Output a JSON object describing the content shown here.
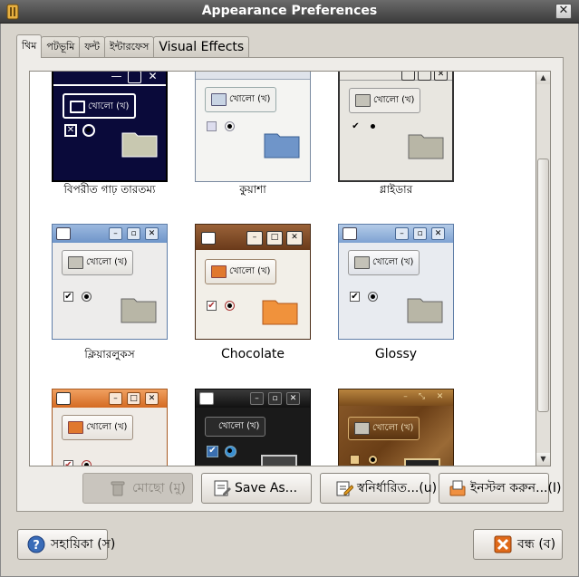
{
  "window": {
    "title": "Appearance Preferences",
    "close_glyph": "✕"
  },
  "tabs": [
    {
      "label": "থিম"
    },
    {
      "label": "পটভূমি"
    },
    {
      "label": "ফন্ট"
    },
    {
      "label": "ইন্টারফেস"
    },
    {
      "label": "Visual Effects"
    }
  ],
  "themes": [
    {
      "label": "বিপরীত গাঢ় তারতম্য",
      "button_text": "খোলো (খ)",
      "english": false
    },
    {
      "label": "কুয়াশা",
      "button_text": "খোলো (খ)",
      "english": false
    },
    {
      "label": "গ্লাইডার",
      "button_text": "খোলো (খ)",
      "english": false
    },
    {
      "label": "ক্লিয়ারলুকস",
      "button_text": "খোলো (খ)",
      "english": false
    },
    {
      "label": "Chocolate",
      "button_text": "খোলো (খ)",
      "english": true
    },
    {
      "label": "Glossy",
      "button_text": "খোলো (খ)",
      "english": true
    },
    {
      "label": "",
      "button_text": "খোলো (খ)",
      "english": false
    },
    {
      "label": "",
      "button_text": "খোলো (খ)",
      "english": false
    },
    {
      "label": "",
      "button_text": "খোলো (খ)",
      "english": false
    }
  ],
  "actions": {
    "delete_label": "মোছো (মু)",
    "save_as_label": "Save As...",
    "customize_label": "স্বনির্ধারিত...(u)",
    "install_label": "ইনস্টল করুন...(I)"
  },
  "footer": {
    "help_label": "সহায়িকা (স)",
    "close_label": "বন্ধ (ব)"
  },
  "colors": {
    "accent_blue": "#6f95c9",
    "chocolate": "#7a4a2a",
    "orange": "#e0782e",
    "dark": "#1a1a1a"
  }
}
